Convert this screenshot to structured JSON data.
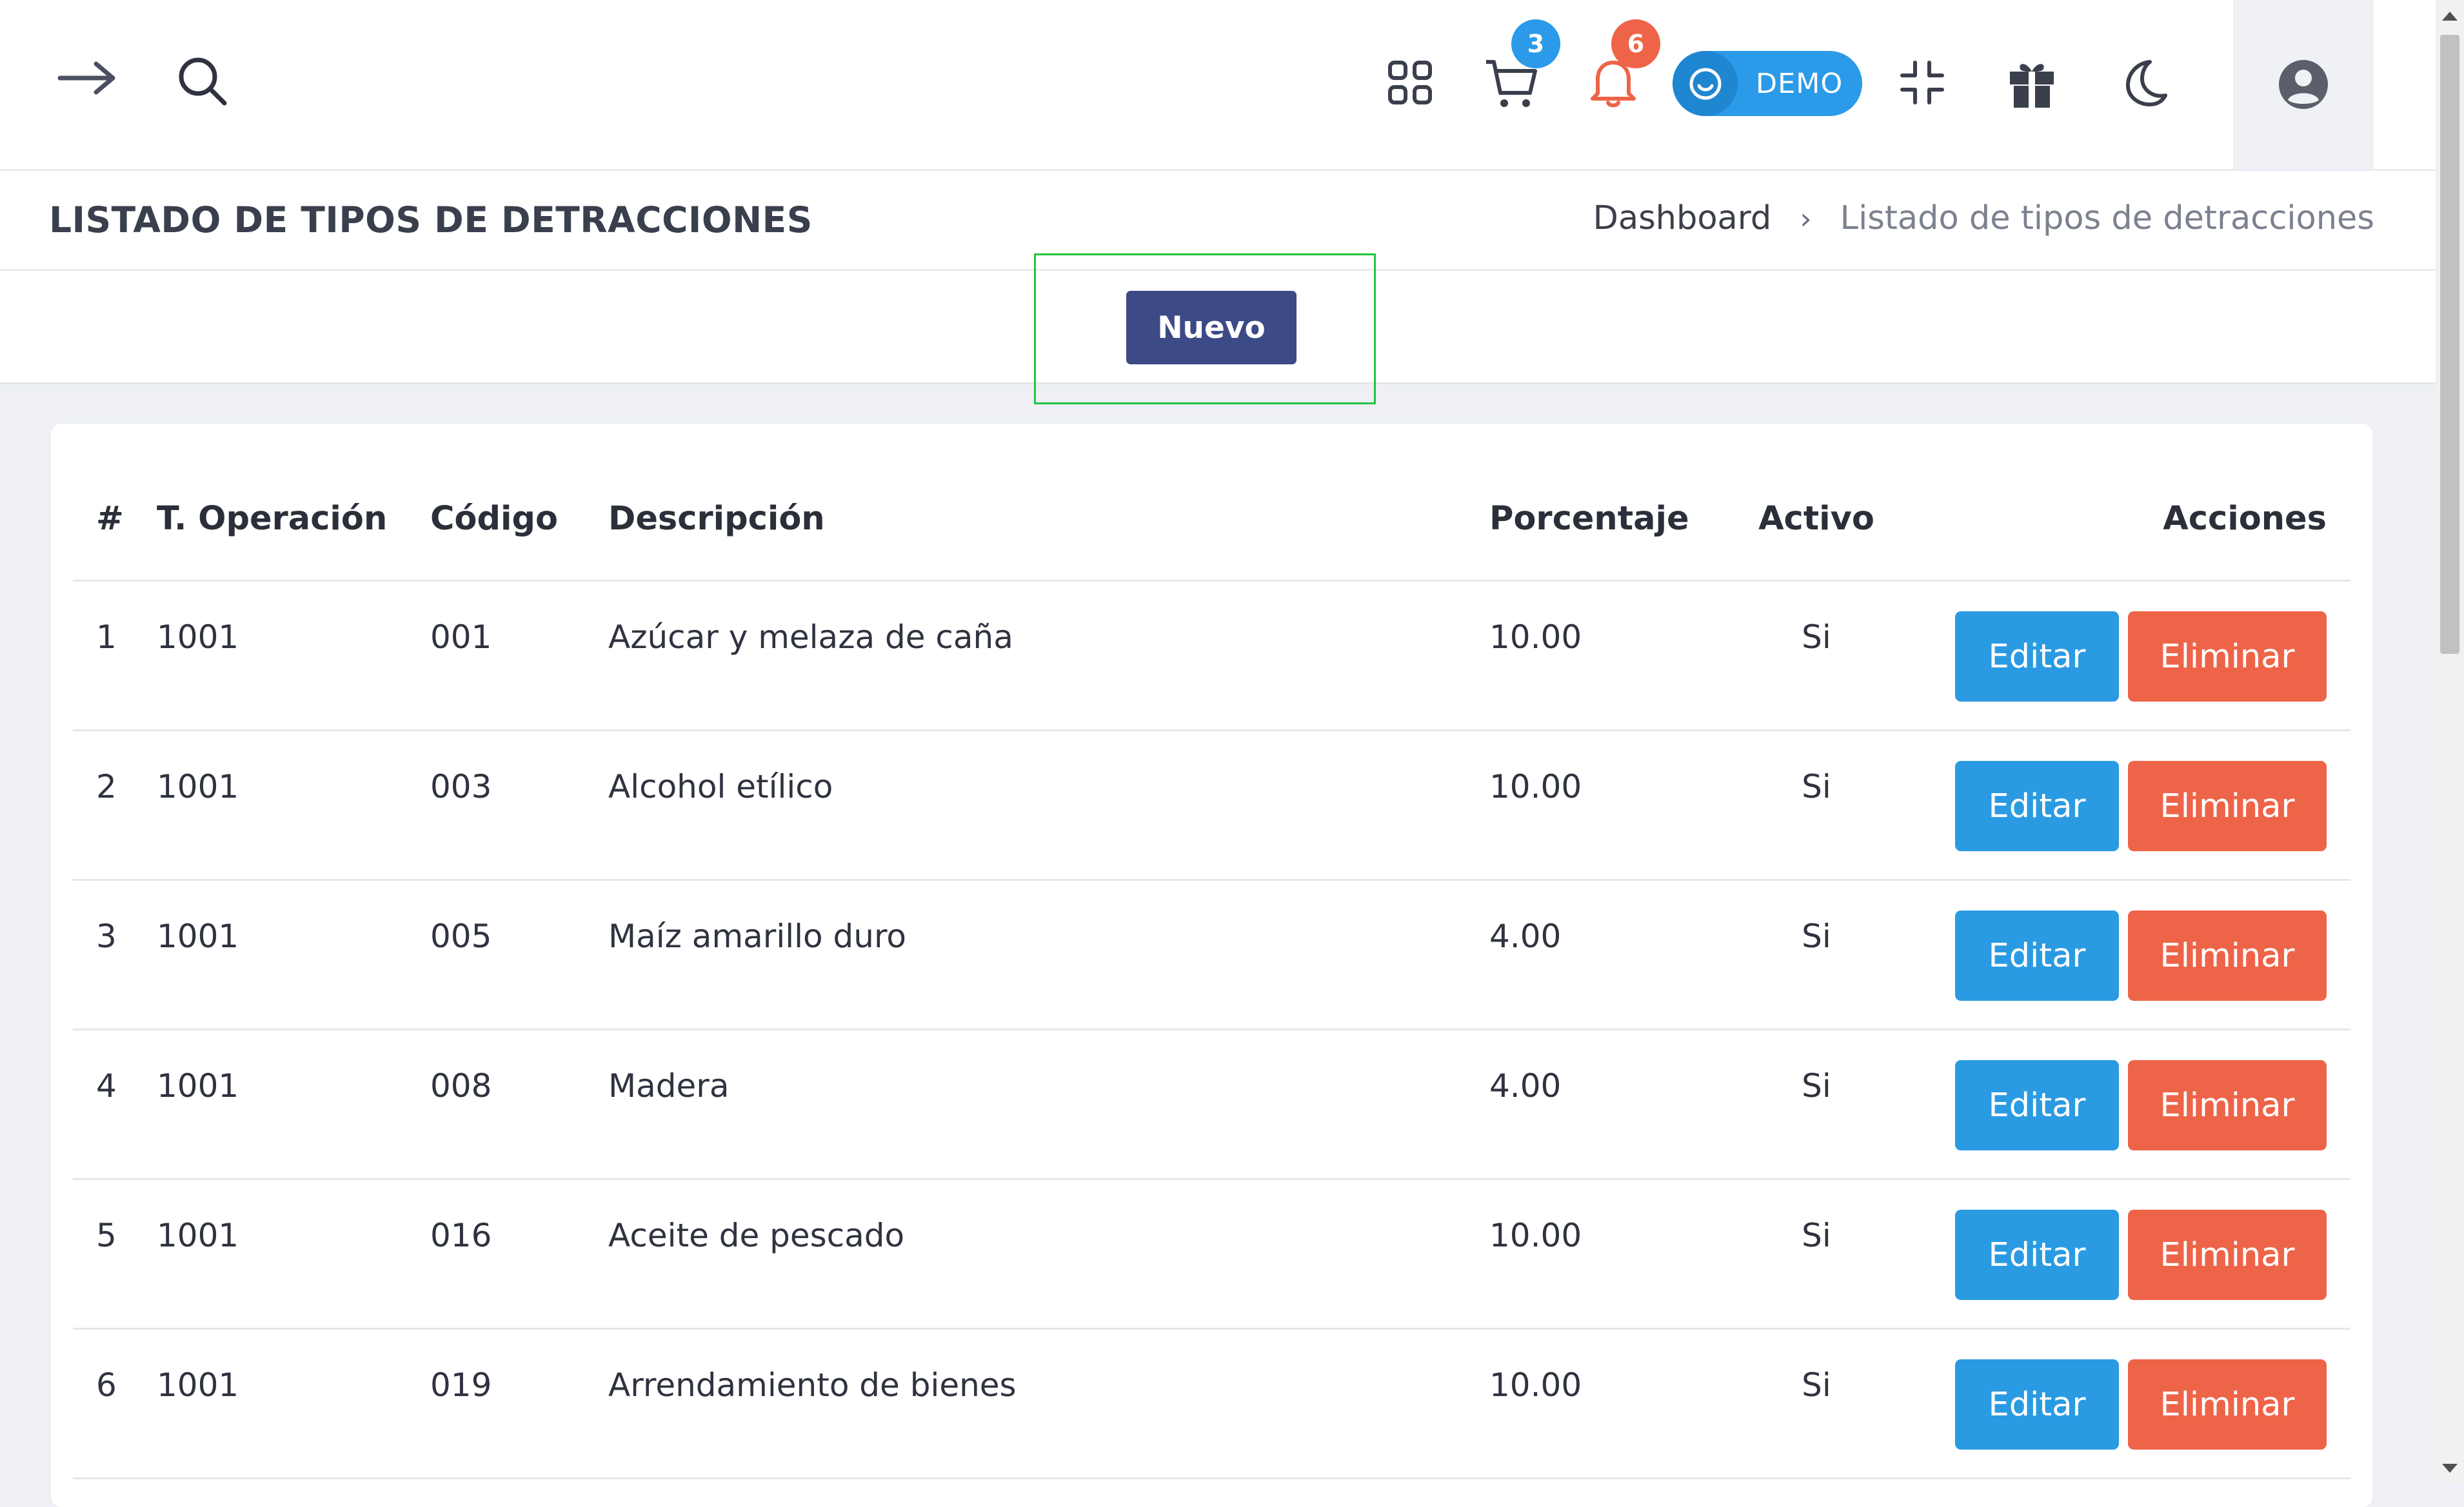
{
  "header": {
    "cart_count": "3",
    "notifications_count": "6",
    "demo_label": "DEMO",
    "icons": [
      "arrow-right-icon",
      "search-icon",
      "apps-grid-icon",
      "cart-icon",
      "bell-icon",
      "smiley-icon",
      "compress-icon",
      "gift-icon",
      "moon-icon",
      "user-circle-icon"
    ],
    "colors": {
      "cart_badge": "#2b9ae8",
      "bell": "#ee6448",
      "demo_pill": "#2b9ae8"
    }
  },
  "page": {
    "title": "LISTADO DE TIPOS DE DETRACCIONES",
    "breadcrumb": {
      "home": "Dashboard",
      "separator": "›",
      "current": "Listado de tipos de detracciones"
    }
  },
  "toolbar": {
    "new_label": "Nuevo"
  },
  "table": {
    "columns": [
      "#",
      "T. Operación",
      "Código",
      "Descripción",
      "Porcentaje",
      "Activo",
      "Acciones"
    ],
    "edit_label": "Editar",
    "delete_label": "Eliminar",
    "rows": [
      {
        "num": "1",
        "op": "1001",
        "code": "001",
        "desc": "Azúcar y melaza de caña",
        "pct": "10.00",
        "active": "Si"
      },
      {
        "num": "2",
        "op": "1001",
        "code": "003",
        "desc": "Alcohol etílico",
        "pct": "10.00",
        "active": "Si"
      },
      {
        "num": "3",
        "op": "1001",
        "code": "005",
        "desc": "Maíz amarillo duro",
        "pct": "4.00",
        "active": "Si"
      },
      {
        "num": "4",
        "op": "1001",
        "code": "008",
        "desc": "Madera",
        "pct": "4.00",
        "active": "Si"
      },
      {
        "num": "5",
        "op": "1001",
        "code": "016",
        "desc": "Aceite de pescado",
        "pct": "10.00",
        "active": "Si"
      },
      {
        "num": "6",
        "op": "1001",
        "code": "019",
        "desc": "Arrendamiento de bienes",
        "pct": "10.00",
        "active": "Si"
      }
    ]
  }
}
